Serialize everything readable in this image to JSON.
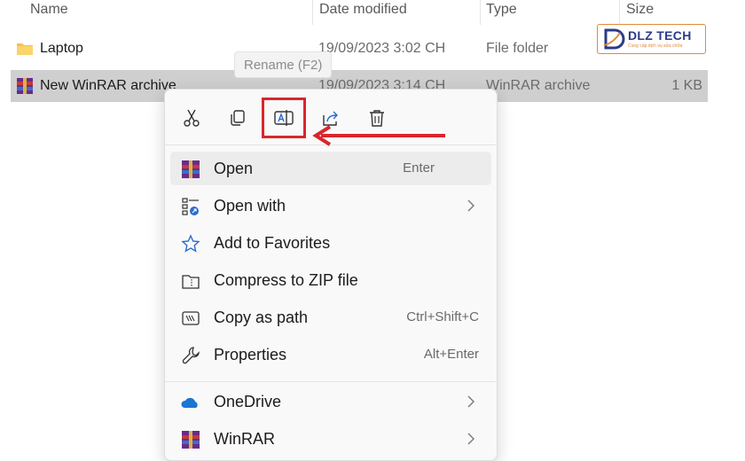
{
  "columns": {
    "name": "Name",
    "date_modified": "Date modified",
    "type": "Type",
    "size": "Size"
  },
  "rows": [
    {
      "name": "Laptop",
      "date": "19/09/2023 3:02 CH",
      "type": "File folder",
      "size": "",
      "icon": "folder-icon"
    },
    {
      "name": "New WinRAR archive",
      "date": "19/09/2023 3:14 CH",
      "type": "WinRAR archive",
      "size": "1 KB",
      "icon": "winrar-icon"
    }
  ],
  "watermark": {
    "text": "DLZ TECH",
    "subtext": "Cung cấp dịch vụ sửa chữa",
    "accent": "#e08a3c",
    "brand": "#2c3b86"
  },
  "tooltip": "Rename (F2)",
  "toolbar": [
    "cut-icon",
    "copy-icon",
    "rename-icon",
    "share-icon",
    "delete-icon"
  ],
  "menu": {
    "items": [
      {
        "label": "Open",
        "shortcut": "Enter",
        "icon": "winrar-icon",
        "submenu": false
      },
      {
        "label": "Open with",
        "shortcut": "",
        "icon": "open-with-icon",
        "submenu": true
      },
      {
        "label": "Add to Favorites",
        "shortcut": "",
        "icon": "star-icon",
        "submenu": false
      },
      {
        "label": "Compress to ZIP file",
        "shortcut": "",
        "icon": "zip-icon",
        "submenu": false
      },
      {
        "label": "Copy as path",
        "shortcut": "Ctrl+Shift+C",
        "icon": "copy-path-icon",
        "submenu": false
      },
      {
        "label": "Properties",
        "shortcut": "Alt+Enter",
        "icon": "wrench-icon",
        "submenu": false
      },
      {
        "label": "OneDrive",
        "shortcut": "",
        "icon": "onedrive-icon",
        "submenu": true
      },
      {
        "label": "WinRAR",
        "shortcut": "",
        "icon": "winrar-icon",
        "submenu": true
      }
    ]
  },
  "annotation_color": "#d9262c"
}
